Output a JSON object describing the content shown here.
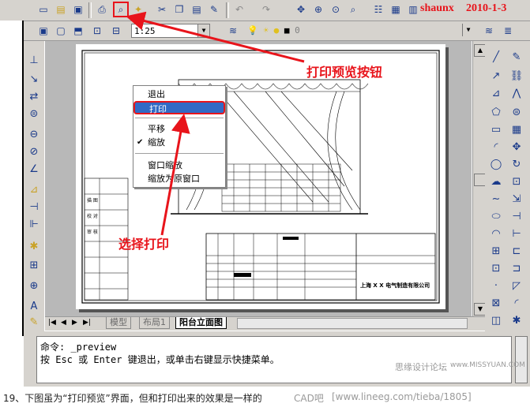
{
  "window": {
    "date_stamp": "2010-1-3",
    "author_stamp": "shaunx"
  },
  "toolbar2": {
    "scale_value": "1:25",
    "layer_value": "0"
  },
  "context_menu": {
    "items": [
      {
        "label": "退出"
      },
      {
        "label": "打印",
        "selected": true
      },
      {
        "label": "平移"
      },
      {
        "label": "缩放",
        "checked": true,
        "check_mark": "✔"
      },
      {
        "label": "窗口缩放"
      },
      {
        "label": "缩放为原窗口"
      }
    ]
  },
  "annotations": {
    "preview_button": "打印预览按钮",
    "select_print": "选择打印"
  },
  "drawing": {
    "company": "上海 X X 电气制造有限公司",
    "row_labels": [
      "描",
      "校",
      "核",
      "标准化"
    ],
    "left_cells": [
      "描 图",
      "校 对",
      "审 核"
    ]
  },
  "tabs": [
    {
      "label": "模型"
    },
    {
      "label": "布局1"
    },
    {
      "label": "阳台立面图",
      "active": true
    }
  ],
  "command": {
    "line1": "命令: _preview",
    "line2": "按 Esc 或 Enter 键退出，或单击右键显示快捷菜单。"
  },
  "footer": {
    "caption": "19、下图虽为“打印预览”界面，但和打印出来的效果是一样的",
    "watermark_cad": "CAD吧",
    "watermark_url": "[www.lineeg.com/tieba/1805]",
    "watermark_site": "思缘设计论坛",
    "watermark_site_url": "www.MISSYUAN.COM"
  }
}
